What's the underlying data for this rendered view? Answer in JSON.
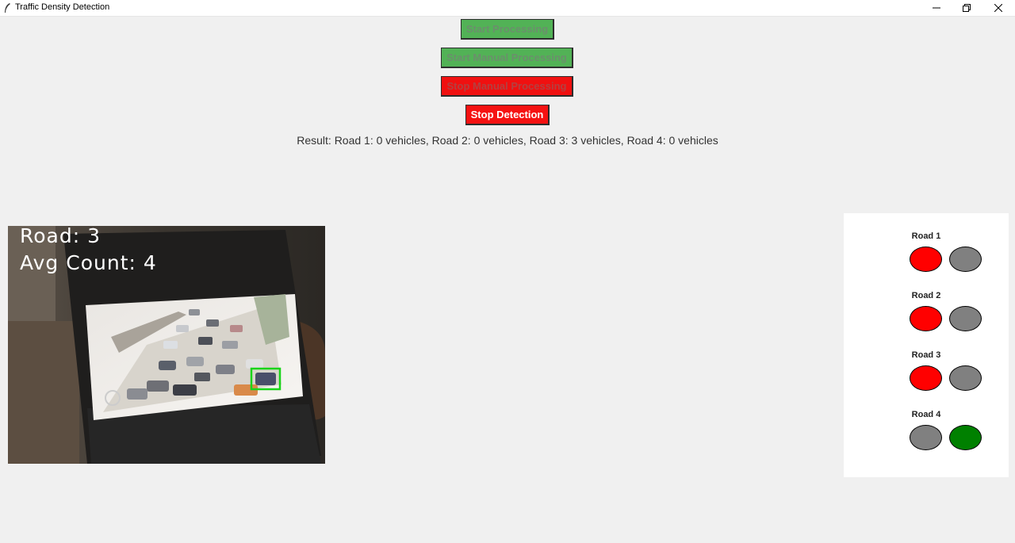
{
  "window": {
    "title": "Traffic Density Detection"
  },
  "buttons": {
    "start_processing": "Start Processing",
    "start_manual": "Start Manual Processing",
    "stop_manual": "Stop Manual Processing",
    "stop_detection": "Stop Detection"
  },
  "result": {
    "text": "Result: Road 1: 0 vehicles, Road 2: 0 vehicles, Road 3: 3 vehicles, Road 4: 0 vehicles"
  },
  "video": {
    "road_text": "Road: 3",
    "avg_count_text": "Avg Count: 4"
  },
  "signals": [
    {
      "label": "Road 1",
      "red_on": true,
      "green_on": false
    },
    {
      "label": "Road 2",
      "red_on": true,
      "green_on": false
    },
    {
      "label": "Road 3",
      "red_on": true,
      "green_on": false
    },
    {
      "label": "Road 4",
      "red_on": false,
      "green_on": true
    }
  ],
  "colors": {
    "red_on": "#ff0000",
    "green_on": "#008000",
    "off": "#808080",
    "button_green": "#52b256",
    "button_red": "#f51212"
  }
}
